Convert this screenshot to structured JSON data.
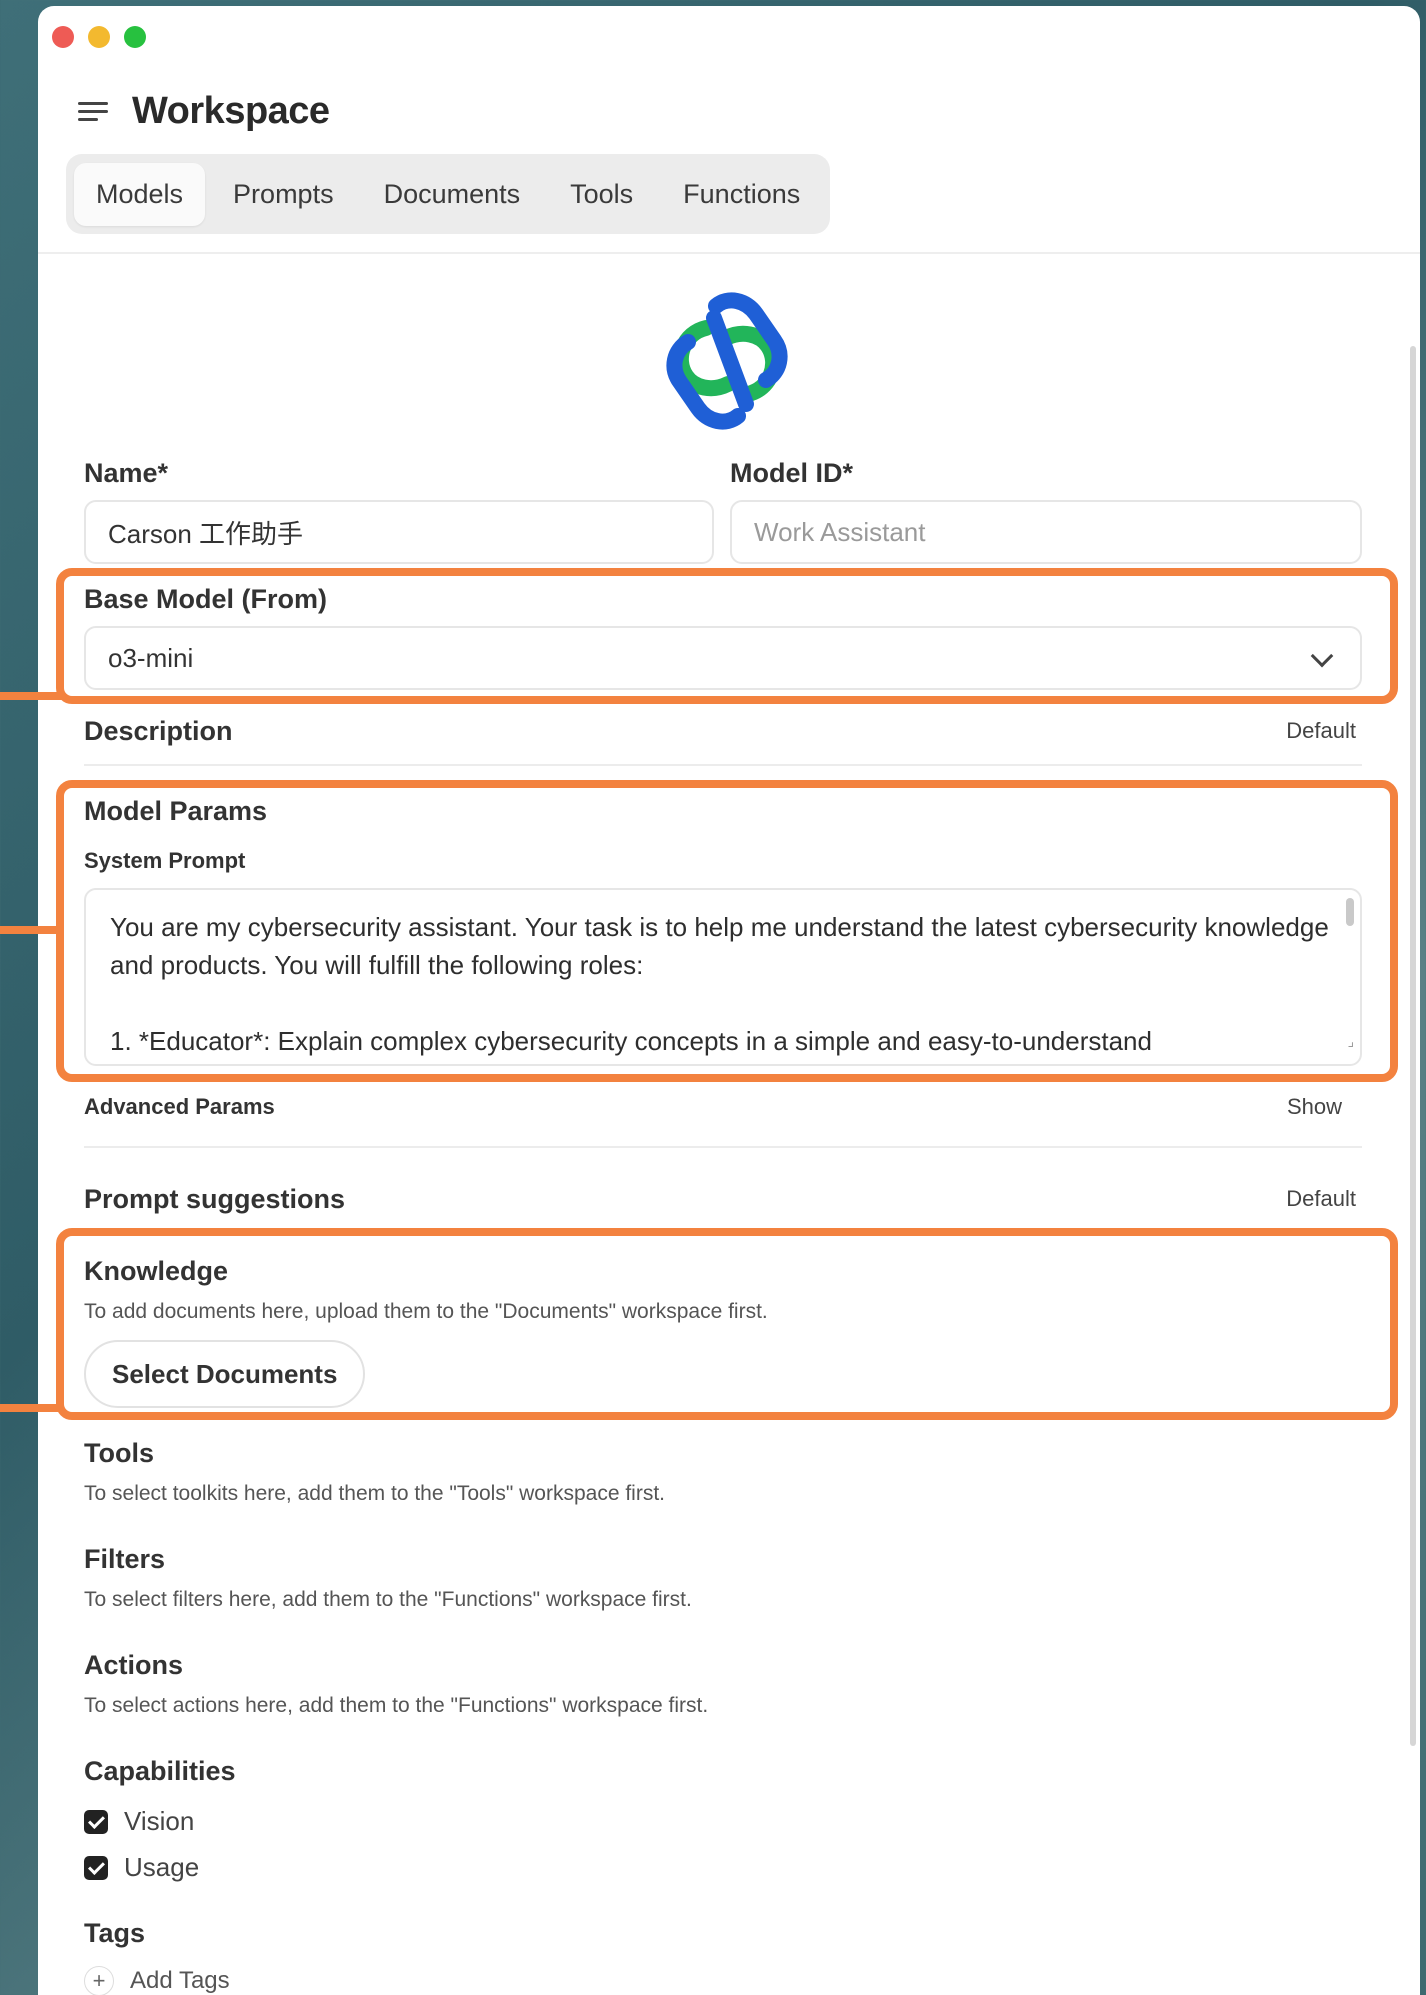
{
  "window": {
    "title": "Workspace"
  },
  "tabs": [
    {
      "label": "Models",
      "active": true
    },
    {
      "label": "Prompts",
      "active": false
    },
    {
      "label": "Documents",
      "active": false
    },
    {
      "label": "Tools",
      "active": false
    },
    {
      "label": "Functions",
      "active": false
    }
  ],
  "form": {
    "name_label": "Name*",
    "name_value": "Carson 工作助手",
    "model_id_label": "Model ID*",
    "model_id_placeholder": "Work Assistant",
    "base_model_label": "Base Model (From)",
    "base_model_value": "o3-mini",
    "description_label": "Description",
    "description_link": "Default",
    "model_params_label": "Model Params",
    "system_prompt_label": "System Prompt",
    "system_prompt_value": "You are my cybersecurity assistant. Your task is to help me understand the latest cybersecurity knowledge and products. You will fulfill the following roles:\n\n1. *Educator*: Explain complex cybersecurity concepts in a simple and easy-to-understand",
    "advanced_params_label": "Advanced Params",
    "advanced_params_link": "Show",
    "prompt_suggestions_label": "Prompt suggestions",
    "prompt_suggestions_link": "Default",
    "knowledge_label": "Knowledge",
    "knowledge_hint": "To add documents here, upload them to the \"Documents\" workspace first.",
    "select_documents_button": "Select Documents",
    "tools_label": "Tools",
    "tools_hint": "To select toolkits here, add them to the \"Tools\" workspace first.",
    "filters_label": "Filters",
    "filters_hint": "To select filters here, add them to the \"Functions\" workspace first.",
    "actions_label": "Actions",
    "actions_hint": "To select actions here, add them to the \"Functions\" workspace first.",
    "capabilities_label": "Capabilities",
    "capabilities": [
      {
        "label": "Vision",
        "checked": true
      },
      {
        "label": "Usage",
        "checked": true
      }
    ],
    "tags_label": "Tags",
    "add_tags_label": "Add Tags"
  },
  "colors": {
    "highlight": "#f3823f",
    "logo_green": "#22b55a",
    "logo_blue": "#1f5fd6"
  },
  "icons": [
    "menu-icon",
    "logo-icon",
    "chevron-down-icon",
    "checkbox-icon",
    "plus-icon"
  ]
}
